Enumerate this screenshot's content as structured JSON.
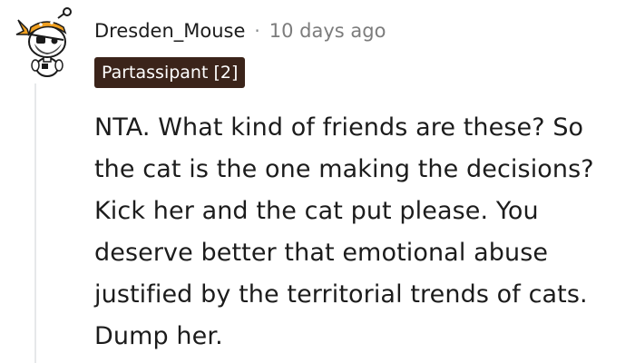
{
  "comment": {
    "author": "Dresden_Mouse",
    "separator": "·",
    "time_ago": "10 days ago",
    "flair": "Partassipant [2]",
    "avatar": "reddit-snoo-pirate-avatar-icon",
    "body_lines": [
      "NTA. What kind of friends are these? So",
      "the cat is the one making the decisions?",
      "Kick her and the cat put please. You",
      "deserve better that emotional abuse",
      "justified by the territorial trends of cats.",
      "Dump her."
    ]
  },
  "colors": {
    "flair_background": "#3b241a",
    "flair_text": "#ffffff",
    "avatar_bandana": "#f0a020",
    "meta_text": "#7c7c7c",
    "thread_line": "#e6e8ea"
  }
}
